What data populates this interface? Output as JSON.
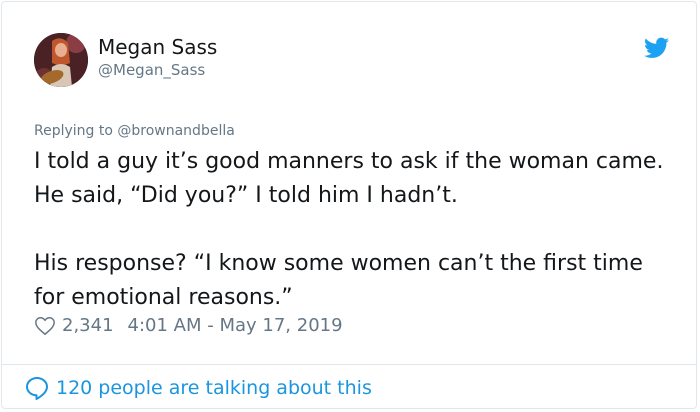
{
  "tweet": {
    "display_name": "Megan Sass",
    "handle": "@Megan_Sass",
    "replying_to": "Replying to @brownandbella",
    "paragraphs": [
      "I told a guy it’s good manners to ask if the woman came. He said, “Did you?” I told him I hadn’t.",
      "His response? “I know some women can’t the first time for emotional reasons.”"
    ],
    "likes": "2,341",
    "timestamp": "4:01 AM - May 17, 2019",
    "talking": "120 people are talking about this"
  },
  "icons": {
    "brand": "twitter-bird-icon",
    "like": "heart-outline-icon",
    "replies": "speech-bubble-icon"
  },
  "colors": {
    "brand_blue": "#1da1f2",
    "link_blue": "#1b95e0",
    "secondary_text": "#657786",
    "primary_text": "#14171a",
    "border": "#e1e8ed"
  }
}
